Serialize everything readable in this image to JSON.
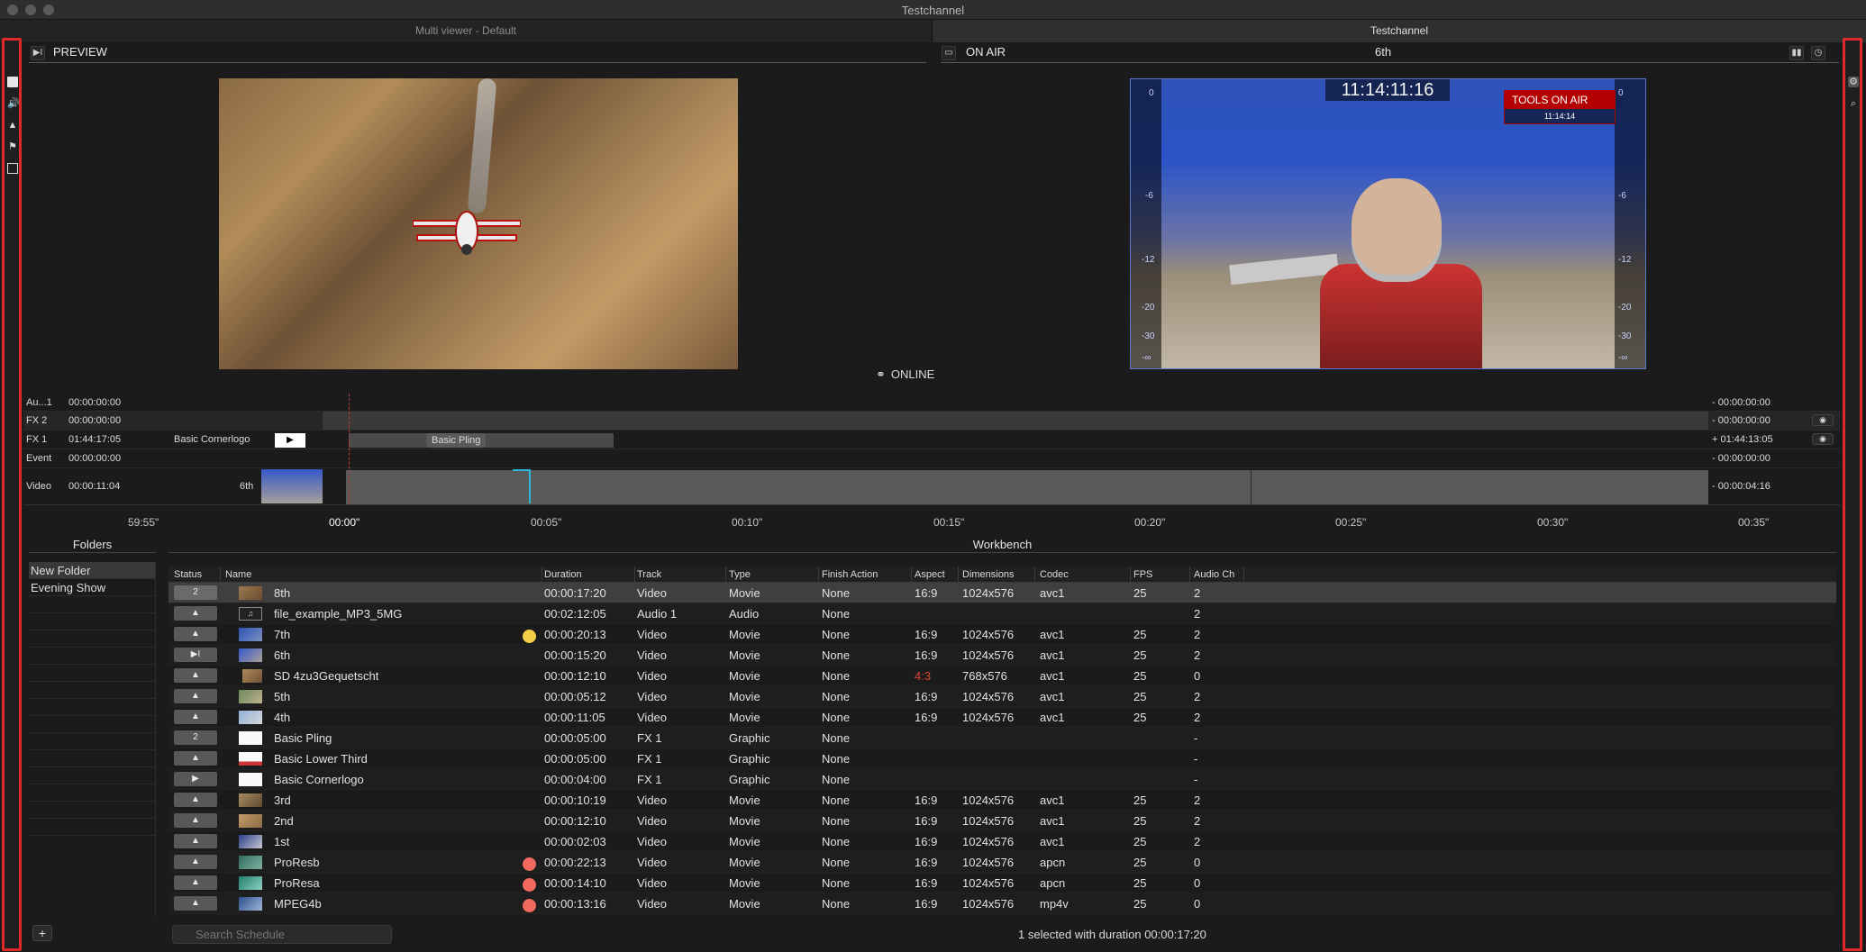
{
  "window": {
    "title": "Testchannel"
  },
  "tabs": [
    {
      "label": "Multi viewer - Default"
    },
    {
      "label": "Testchannel"
    }
  ],
  "preview": {
    "label": "PREVIEW"
  },
  "onair": {
    "label": "ON AIR",
    "clip": "6th",
    "timecode": "11:14:11:16",
    "logo_text": "TOOLS ON AIR",
    "logo_time": "11:14:14"
  },
  "meter_ticks": [
    "0",
    "-6",
    "-12",
    "-20",
    "-30",
    "-∞"
  ],
  "status": {
    "online": "ONLINE"
  },
  "timeline": {
    "rows": [
      {
        "label": "Au...1",
        "time": "00:00:00:00",
        "right": "- 00:00:00:00"
      },
      {
        "label": "FX 2",
        "time": "00:00:00:00",
        "right": "- 00:00:00:00"
      },
      {
        "label": "FX 1",
        "time": "01:44:17:05",
        "clip": "Basic Cornerlogo",
        "clip2": "Basic Pling",
        "right": "+ 01:44:13:05"
      },
      {
        "label": "Event",
        "time": "00:00:00:00",
        "right": "- 00:00:00:00"
      },
      {
        "label": "Video",
        "time": "00:00:11:04",
        "clip": "6th",
        "right": "- 00:00:04:16"
      }
    ],
    "ruler": [
      "59:55\"",
      "00:00\"",
      "00:05\"",
      "00:10\"",
      "00:15\"",
      "00:20\"",
      "00:25\"",
      "00:30\"",
      "00:35\""
    ]
  },
  "folders": {
    "header": "Folders",
    "items": [
      "New Folder",
      "Evening Show"
    ]
  },
  "workbench": {
    "header": "Workbench",
    "columns": [
      "Status",
      "Name",
      "Duration",
      "Track",
      "Type",
      "Finish Action",
      "Aspect",
      "Dimensions",
      "Codec",
      "FPS",
      "Audio Ch"
    ],
    "rows": [
      {
        "status": "2",
        "name": "8th",
        "duration": "00:00:17:20",
        "track": "Video",
        "type": "Movie",
        "finish": "None",
        "aspect": "16:9",
        "dims": "1024x576",
        "codec": "avc1",
        "fps": "25",
        "audio": "2"
      },
      {
        "status": "▲",
        "name": "file_example_MP3_5MG",
        "duration": "00:02:12:05",
        "track": "Audio 1",
        "type": "Audio",
        "finish": "None",
        "aspect": "",
        "dims": "",
        "codec": "",
        "fps": "",
        "audio": "2"
      },
      {
        "status": "▲",
        "name": "7th",
        "duration": "00:00:20:13",
        "track": "Video",
        "type": "Movie",
        "finish": "None",
        "aspect": "16:9",
        "dims": "1024x576",
        "codec": "avc1",
        "fps": "25",
        "audio": "2"
      },
      {
        "status": "▶I",
        "name": "6th",
        "duration": "00:00:15:20",
        "track": "Video",
        "type": "Movie",
        "finish": "None",
        "aspect": "16:9",
        "dims": "1024x576",
        "codec": "avc1",
        "fps": "25",
        "audio": "2"
      },
      {
        "status": "▲",
        "name": "SD 4zu3Gequetscht",
        "duration": "00:00:12:10",
        "track": "Video",
        "type": "Movie",
        "finish": "None",
        "aspect": "4:3",
        "dims": "768x576",
        "codec": "avc1",
        "fps": "25",
        "audio": "0"
      },
      {
        "status": "▲",
        "name": "5th",
        "duration": "00:00:05:12",
        "track": "Video",
        "type": "Movie",
        "finish": "None",
        "aspect": "16:9",
        "dims": "1024x576",
        "codec": "avc1",
        "fps": "25",
        "audio": "2"
      },
      {
        "status": "▲",
        "name": "4th",
        "duration": "00:00:11:05",
        "track": "Video",
        "type": "Movie",
        "finish": "None",
        "aspect": "16:9",
        "dims": "1024x576",
        "codec": "avc1",
        "fps": "25",
        "audio": "2"
      },
      {
        "status": "2",
        "name": "Basic Pling",
        "duration": "00:00:05:00",
        "track": "FX 1",
        "type": "Graphic",
        "finish": "None",
        "aspect": "",
        "dims": "",
        "codec": "",
        "fps": "",
        "audio": "-"
      },
      {
        "status": "▲",
        "name": "Basic Lower Third",
        "duration": "00:00:05:00",
        "track": "FX 1",
        "type": "Graphic",
        "finish": "None",
        "aspect": "",
        "dims": "",
        "codec": "",
        "fps": "",
        "audio": "-"
      },
      {
        "status": "▶",
        "name": "Basic Cornerlogo",
        "duration": "00:00:04:00",
        "track": "FX 1",
        "type": "Graphic",
        "finish": "None",
        "aspect": "",
        "dims": "",
        "codec": "",
        "fps": "",
        "audio": "-"
      },
      {
        "status": "▲",
        "name": "3rd",
        "duration": "00:00:10:19",
        "track": "Video",
        "type": "Movie",
        "finish": "None",
        "aspect": "16:9",
        "dims": "1024x576",
        "codec": "avc1",
        "fps": "25",
        "audio": "2"
      },
      {
        "status": "▲",
        "name": "2nd",
        "duration": "00:00:12:10",
        "track": "Video",
        "type": "Movie",
        "finish": "None",
        "aspect": "16:9",
        "dims": "1024x576",
        "codec": "avc1",
        "fps": "25",
        "audio": "2"
      },
      {
        "status": "▲",
        "name": "1st",
        "duration": "00:00:02:03",
        "track": "Video",
        "type": "Movie",
        "finish": "None",
        "aspect": "16:9",
        "dims": "1024x576",
        "codec": "avc1",
        "fps": "25",
        "audio": "2"
      },
      {
        "status": "▲",
        "name": "ProResb",
        "duration": "00:00:22:13",
        "track": "Video",
        "type": "Movie",
        "finish": "None",
        "aspect": "16:9",
        "dims": "1024x576",
        "codec": "apcn",
        "fps": "25",
        "audio": "0"
      },
      {
        "status": "▲",
        "name": "ProResa",
        "duration": "00:00:14:10",
        "track": "Video",
        "type": "Movie",
        "finish": "None",
        "aspect": "16:9",
        "dims": "1024x576",
        "codec": "apcn",
        "fps": "25",
        "audio": "0"
      },
      {
        "status": "▲",
        "name": "MPEG4b",
        "duration": "00:00:13:16",
        "track": "Video",
        "type": "Movie",
        "finish": "None",
        "aspect": "16:9",
        "dims": "1024x576",
        "codec": "mp4v",
        "fps": "25",
        "audio": "0"
      }
    ]
  },
  "search": {
    "placeholder": "Search Schedule"
  },
  "footer": {
    "selection": "1 selected with duration 00:00:17:20"
  },
  "colors": {
    "accent_red": "#e1292a",
    "warn_yellow": "#f2cf47",
    "error_red": "#f06a5f",
    "aspect_warn": "#e0463b"
  }
}
